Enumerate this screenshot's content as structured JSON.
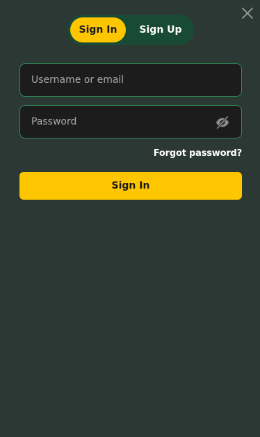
{
  "auth_toggle": {
    "sign_in_label": "Sign In",
    "sign_up_label": "Sign Up",
    "active": "sign_in"
  },
  "form": {
    "username": {
      "placeholder": "Username or email",
      "value": ""
    },
    "password": {
      "placeholder": "Password",
      "value": ""
    },
    "forgot_label": "Forgot password?",
    "submit_label": "Sign In"
  },
  "icons": {
    "close": "close-icon",
    "password_visibility": "eye-off-icon"
  },
  "colors": {
    "background": "#2b3833",
    "accent": "#fec501",
    "toggle_bg": "#184a35",
    "field_bg": "#1c1c1c",
    "field_border": "#2f8a5a"
  }
}
